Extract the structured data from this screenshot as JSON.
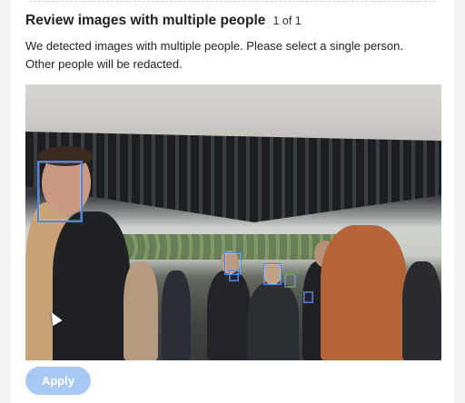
{
  "dialog": {
    "title": "Review images with multiple people",
    "counter": "1 of 1",
    "description": "We detected images with multiple people. Please select a single person. Other people will be redacted."
  },
  "photo": {
    "faces_detected": 6
  },
  "actions": {
    "apply_label": "Apply",
    "apply_color": "#a9c9f5"
  },
  "colors": {
    "face_box": "#4a86e8"
  }
}
